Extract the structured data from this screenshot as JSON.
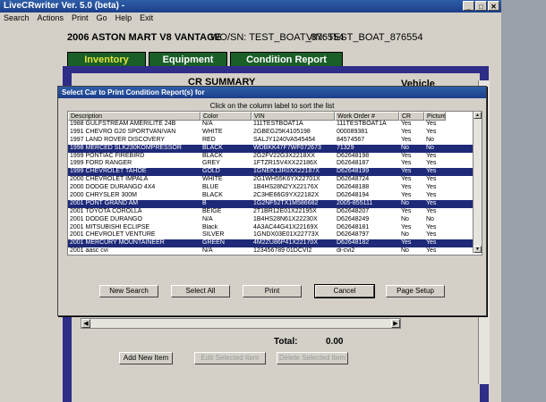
{
  "window": {
    "title": "LiveCRwriter Ver. 5.0 (beta) -"
  },
  "menu": [
    "Search",
    "Actions",
    "Print",
    "Go",
    "Help",
    "Exit"
  ],
  "header": {
    "vehicle": "2006   ASTON MART V8 VANTAGE",
    "wo": "WO/SN: TEST_BOAT_876554",
    "vin": "VIN: TEST_BOAT_876554"
  },
  "tabs": [
    "Inventory",
    "Equipment",
    "Condition Report"
  ],
  "summary": {
    "title": "CR SUMMARY",
    "vehicle_label": "Vehicle"
  },
  "dialog": {
    "title": "Select Car to Print Condition Report(s) for",
    "hint": "Click on the column label to sort the list",
    "columns": [
      "Description",
      "Color",
      "VIN",
      "Work Order #",
      "CR",
      "Picture"
    ],
    "rows": [
      [
        "1988   GULFSTREAM AMERILITE 24B",
        "N/A",
        "111TESTBOAT1A",
        "111TESTBOAT1A",
        "Yes",
        "Yes"
      ],
      [
        "1991   CHEVRO G20 SPORTVAN/VAN",
        "WHITE",
        "2GBEG25K4105198",
        "000089381",
        "Yes",
        "Yes"
      ],
      [
        "1997   LAND ROVER DISCOVERY",
        "RED",
        "SALJY1240VA545454",
        "84574567",
        "Yes",
        "No"
      ],
      [
        "1998   MERCED SLK230KOMPRESSOR",
        "BLACK",
        "WDBKK47F7WF072673",
        "71329",
        "No",
        "No"
      ],
      [
        "1999   PONTIAC FIREBIRD",
        "BLACK",
        "2G2FV22G3X2218XX",
        "D62648198",
        "Yes",
        "Yes"
      ],
      [
        "1999   FORD RANGER",
        "GREY",
        "1FTZR15V4XX22186X",
        "D62648187",
        "Yes",
        "Yes"
      ],
      [
        "1999   CHEVROLET TAHOE",
        "GOLD",
        "1GNEK13R0XX22187X",
        "D62648199",
        "Yes",
        "Yes"
      ],
      [
        "2000   CHEVROLET IMPALA",
        "WHITE",
        "2G1WH55K6YX22701X",
        "D62648724",
        "Yes",
        "Yes"
      ],
      [
        "2000   DODGE DURANGO 4X4",
        "BLUE",
        "1B4HS28N2YX22176X",
        "D62648188",
        "Yes",
        "Yes"
      ],
      [
        "2000   CHRYSLER 300M",
        "BLACK",
        "2C3HE66G9YX22182X",
        "D62648194",
        "Yes",
        "Yes"
      ],
      [
        "2001   PONT GRAND AM",
        "B",
        "1G2NF52TX1M586682",
        "2005-855111",
        "No",
        "Yes"
      ],
      [
        "2001   TOYOTA COROLLA",
        "BEIGE",
        "2T1BR12E01X22195X",
        "D62648207",
        "Yes",
        "Yes"
      ],
      [
        "2001   DODGE DURANGO",
        "N/A",
        "1B4HS28N61X22230X",
        "D62648249",
        "No",
        "No"
      ],
      [
        "2001   MITSUBISHI ECLIPSE",
        "Black",
        "4A3AC44G41X22169X",
        "D62648181",
        "Yes",
        "Yes"
      ],
      [
        "2001   CHEVROLET VENTURE",
        "SILVER",
        "1GNDX03E01X22773X",
        "D62648797",
        "No",
        "Yes"
      ],
      [
        "2001   MERCURY MOUNTAINEER",
        "GREEN",
        "4M2ZU86P41X22170X",
        "D62648182",
        "Yes",
        "Yes"
      ],
      [
        "2001   aasc cvi",
        "N/A",
        "123456789 01DCVI2",
        "di-cvi2",
        "No",
        "Yes"
      ],
      [
        "2001   NISSAN MAXIMA",
        "Gray",
        "JN1CA31A21T27695X",
        "222",
        "No",
        "Yes"
      ]
    ],
    "selected_rows": [
      3,
      6,
      10,
      15
    ],
    "buttons": [
      "New Search",
      "Select All",
      "Print",
      "Cancel",
      "Page Setup"
    ]
  },
  "footer": {
    "total_label": "Total:",
    "total_value": "0.00",
    "buttons": [
      "Add New Item",
      "Edit Selected Item",
      "Delete Selected Item"
    ]
  }
}
